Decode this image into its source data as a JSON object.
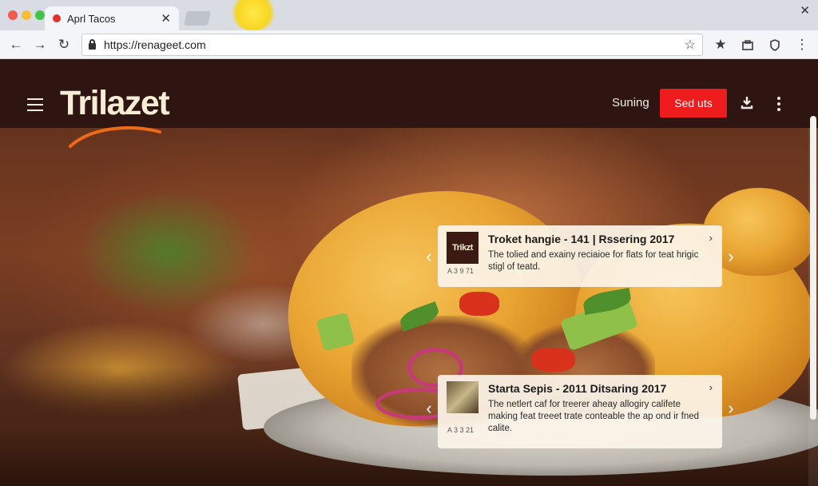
{
  "browser": {
    "tab": {
      "title": "Aprl Tacos"
    },
    "address_bar": {
      "url": "https://renageet.com"
    },
    "colors": {
      "traffic_red": "#f05b54",
      "traffic_yellow": "#f6bd3b",
      "traffic_green": "#3fc54a"
    }
  },
  "site": {
    "logo": "Trilazet",
    "nav": {
      "link": "Suning",
      "cta": "Sed uts"
    },
    "colors": {
      "header_bg": "#2e1512",
      "cta_bg": "#ee1c1c",
      "logo_swoosh": "#ee6a17"
    }
  },
  "cards": [
    {
      "title": "Troket hangie - 141 | Rssering 2017",
      "description": "The tolied and exainy reciaioe for flats for teat hrigic stigl of teatd.",
      "meta": "A 3 9  71",
      "thumb_label": "Trikzt"
    },
    {
      "title": "Starta Sepis - 2011 Ditsaring 2017",
      "description": "The netlert caf for treerer aheay allogiry califete making feat treeet trate conteable the ap ond ir fned calite.",
      "meta": "A 3 3  21"
    }
  ]
}
